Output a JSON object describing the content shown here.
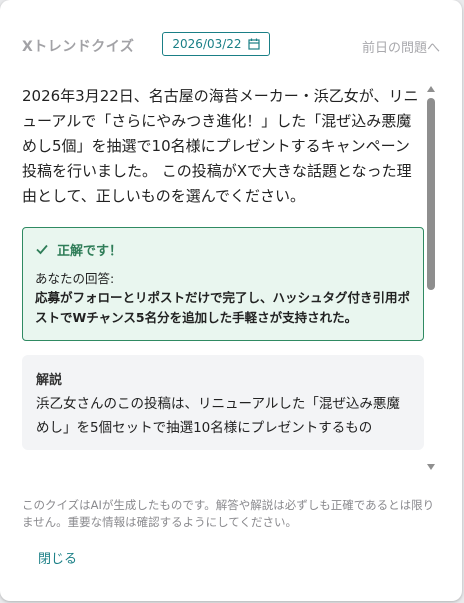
{
  "header": {
    "title": "Xトレンドクイズ",
    "date": "2026/03/22",
    "prev_link": "前日の問題へ"
  },
  "question": "2026年3月22日、名古屋の海苔メーカー・浜乙女が、リニューアルで「さらにやみつき進化！」した「混ぜ込み悪魔めし5個」を抽選で10名様にプレゼントするキャンペーン投稿を行いました。 この投稿がXで大きな話題となった理由として、正しいものを選んでください。",
  "result": {
    "status": "正解です！",
    "your_answer_label": "あなたの回答:",
    "your_answer": "応募がフォローとリポストだけで完了し、ハッシュタグ付き引用ポストでWチャンス5名分を追加した手軽さが支持された。",
    "color": "#2f7d58"
  },
  "explanation": {
    "heading": "解説",
    "text": "浜乙女さんのこの投稿は、リニューアルした「混ぜ込み悪魔めし」を5個セットで抽選10名様にプレゼントするもの"
  },
  "disclaimer": "このクイズはAIが生成したものです。解答や解説は必ずしも正確であるとは限りません。重要な情報は確認するようにしてください。",
  "footer": {
    "close_label": "閉じる"
  },
  "colors": {
    "accent": "#1a7f86",
    "success": "#2f7d58",
    "success_bg": "#e9f6ef"
  }
}
